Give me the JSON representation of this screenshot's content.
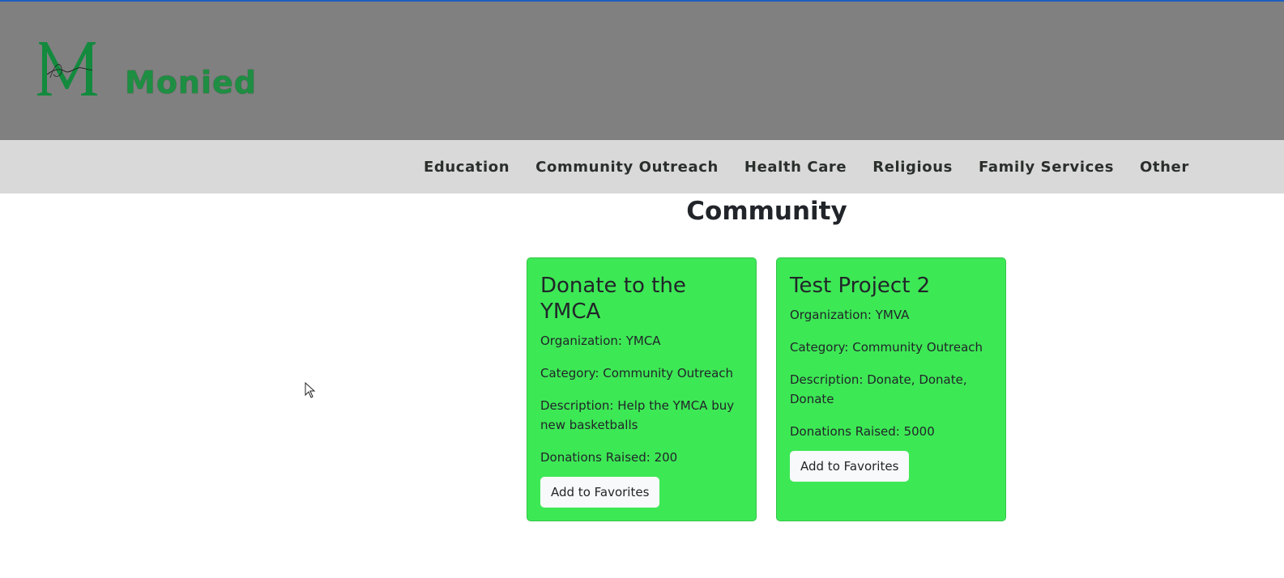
{
  "brand": {
    "name": "Monied",
    "logo_icon": "monied-logo-icon",
    "brand_color": "#1e8f42"
  },
  "nav": {
    "items": [
      {
        "label": "Education"
      },
      {
        "label": "Community Outreach"
      },
      {
        "label": "Health Care"
      },
      {
        "label": "Religious"
      },
      {
        "label": "Family Services"
      },
      {
        "label": "Other"
      }
    ]
  },
  "page": {
    "title": "Community"
  },
  "cards": [
    {
      "title": "Donate to the YMCA",
      "organization": "Organization: YMCA",
      "category": "Category: Community Outreach",
      "description": "Description: Help the YMCA buy new basketballs",
      "donations": "Donations Raised: 200",
      "button_label": "Add to Favorites"
    },
    {
      "title": "Test Project 2",
      "organization": "Organization: YMVA",
      "category": "Category: Community Outreach",
      "description": "Description: Donate, Donate, Donate",
      "donations": "Donations Raised: 5000",
      "button_label": "Add to Favorites"
    }
  ],
  "colors": {
    "header_bg": "#808080",
    "nav_bg": "#d9d9d9",
    "card_bg": "#3de855",
    "accent_line": "#1f5fbf"
  }
}
